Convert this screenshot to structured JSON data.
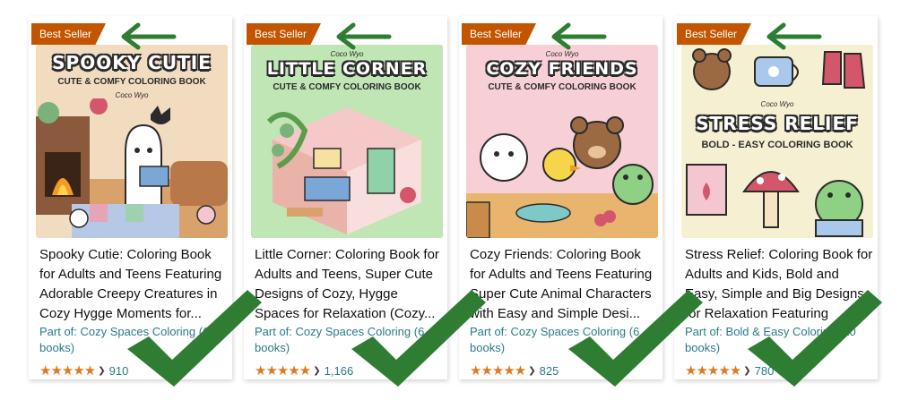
{
  "colors": {
    "badge": "#c45500",
    "arrow": "#2e7d32",
    "star": "#de7921",
    "link": "#2a7a8a",
    "check": "#2e7d32"
  },
  "cards": [
    {
      "badge": "Best Seller",
      "cover": {
        "title_line1": "SPOOKY CUTIE",
        "title_line2": "",
        "subtitle": "CUTE & COMFY COLORING BOOK",
        "author": "Coco Wyo",
        "bg": "#f2dcc0"
      },
      "title": "Spooky Cutie: Coloring Book for Adults and Teens Featuring Adorable Creepy Creatures in Cozy Hygge Moments for...",
      "series": "Part of: Cozy Spaces Coloring (6 books)",
      "stars": "★★★★★",
      "rating_value": 4.5,
      "rating_count": "910"
    },
    {
      "badge": "Best Seller",
      "cover": {
        "title_line1": "LITTLE CORNER",
        "title_line2": "",
        "subtitle": "CUTE & COMFY COLORING BOOK",
        "author": "Coco Wyo",
        "bg": "#bfe6b4"
      },
      "title": "Little Corner: Coloring Book for Adults and Teens, Super Cute Designs of Cozy, Hygge Spaces for Relaxation (Cozy...",
      "series": "Part of: Cozy Spaces Coloring (6 books)",
      "stars": "★★★★★",
      "rating_value": 4.5,
      "rating_count": "1,166"
    },
    {
      "badge": "Best Seller",
      "cover": {
        "title_line1": "COZY FRIENDS",
        "title_line2": "",
        "subtitle": "CUTE & COMFY COLORING BOOK",
        "author": "Coco Wyo",
        "bg": "#f7cfd7"
      },
      "title": "Cozy Friends: Coloring Book for Adults and Teens Featuring Super Cute Animal Characters with Easy and Simple Desi...",
      "series": "Part of: Cozy Spaces Coloring (6 books)",
      "stars": "★★★★★",
      "rating_value": 4.5,
      "rating_count": "825"
    },
    {
      "badge": "Best Seller",
      "cover": {
        "title_line1": "STRESS RELIEF",
        "title_line2": "",
        "subtitle": "BOLD - EASY COLORING BOOK",
        "author": "Coco Wyo",
        "bg": "#f6f0d2"
      },
      "title": "Stress Relief: Coloring Book for Adults and Kids, Bold and Easy, Simple and Big Designs for Relaxation Featuring Animals...",
      "series": "Part of: Bold & Easy Coloring (10 books)",
      "stars": "★★★★★",
      "rating_value": 4.5,
      "rating_count": "780"
    }
  ]
}
